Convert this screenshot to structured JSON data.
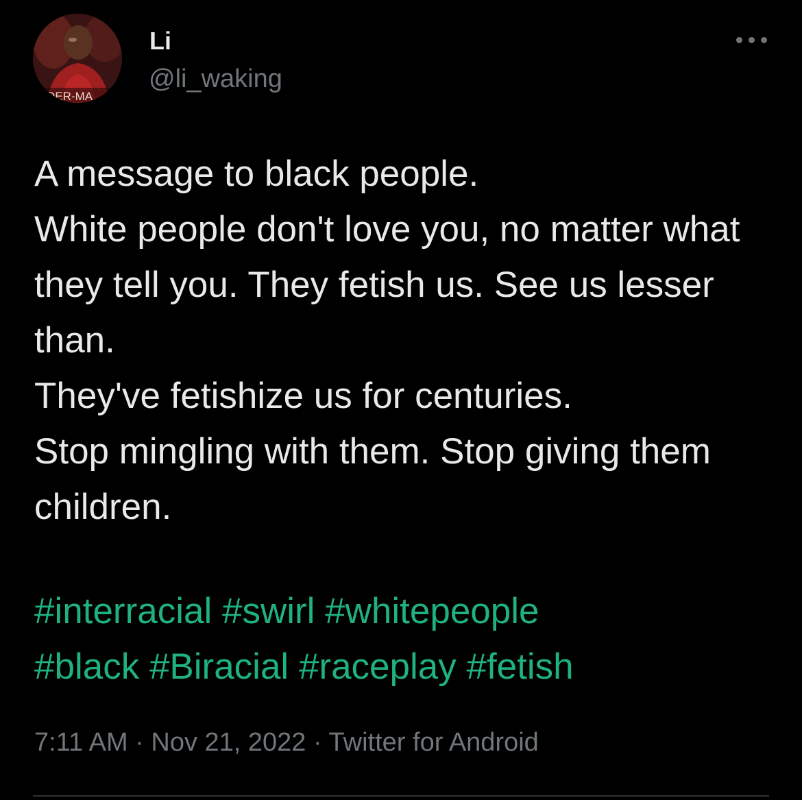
{
  "author": {
    "display_name": "Li",
    "handle": "@li_waking",
    "avatar_caption": "PIDER-MA"
  },
  "tweet": {
    "text": "A message to black people.\nWhite people don't love you, no matter what they tell you. They fetish us. See us lesser than.\nThey've fetishize us for centuries.\nStop mingling with them. Stop giving them children.",
    "hashtags": [
      "#interracial",
      "#swirl",
      "#whitepeople",
      "#black",
      "#Biracial",
      "#raceplay",
      "#fetish"
    ]
  },
  "meta": {
    "time": "7:11 AM",
    "date": "Nov 21, 2022",
    "source": "Twitter for Android",
    "separator": "·"
  },
  "icons": {
    "more": "more-horizontal-icon"
  },
  "colors": {
    "background": "#000000",
    "text_primary": "#e7e9ea",
    "text_secondary": "#71767b",
    "hashtag": "#1fb27f",
    "divider": "#2f3336"
  }
}
